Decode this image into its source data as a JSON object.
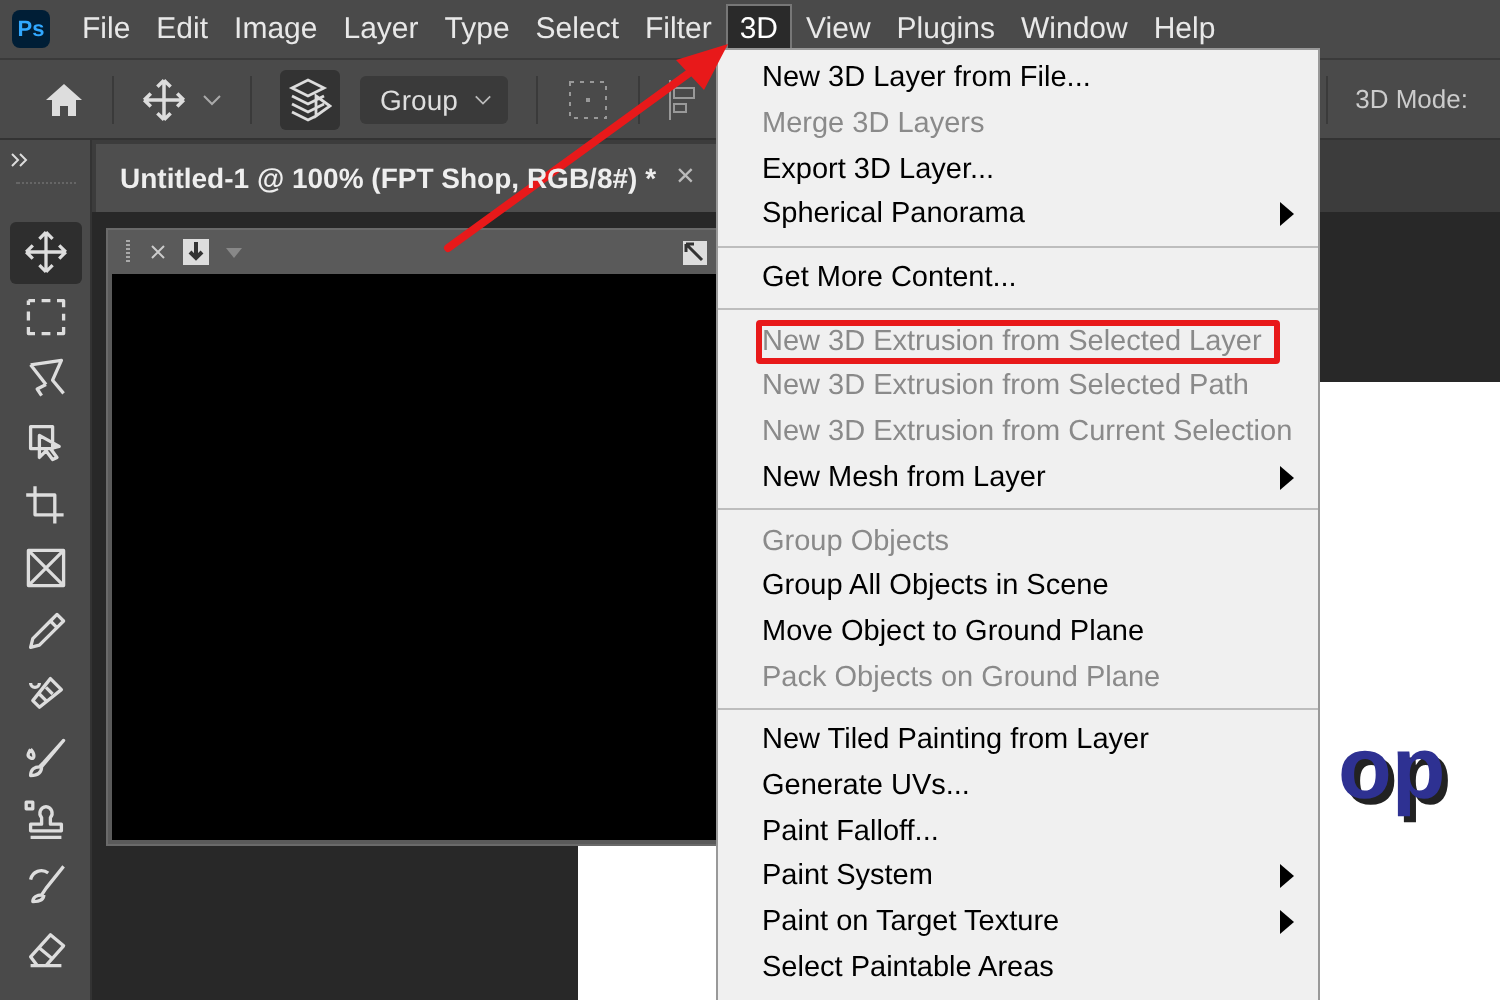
{
  "app_logo": "Ps",
  "menubar": [
    {
      "label": "File",
      "selected": false
    },
    {
      "label": "Edit",
      "selected": false
    },
    {
      "label": "Image",
      "selected": false
    },
    {
      "label": "Layer",
      "selected": false
    },
    {
      "label": "Type",
      "selected": false
    },
    {
      "label": "Select",
      "selected": false
    },
    {
      "label": "Filter",
      "selected": false
    },
    {
      "label": "3D",
      "selected": true
    },
    {
      "label": "View",
      "selected": false
    },
    {
      "label": "Plugins",
      "selected": false
    },
    {
      "label": "Window",
      "selected": false
    },
    {
      "label": "Help",
      "selected": false
    }
  ],
  "options_bar": {
    "group_dropdown": "Group",
    "mode_label": "3D Mode:"
  },
  "document_tab": {
    "title": "Untitled-1 @ 100% (FPT Shop, RGB/8#) *",
    "close": "×"
  },
  "canvas_text": "op",
  "tools": [
    {
      "kind": "move",
      "selected": true
    },
    {
      "kind": "marquee",
      "selected": false
    },
    {
      "kind": "lasso",
      "selected": false
    },
    {
      "kind": "object-select",
      "selected": false
    },
    {
      "kind": "crop",
      "selected": false
    },
    {
      "kind": "frame",
      "selected": false
    },
    {
      "kind": "eyedropper",
      "selected": false
    },
    {
      "kind": "healing",
      "selected": false
    },
    {
      "kind": "brush",
      "selected": false
    },
    {
      "kind": "stamp",
      "selected": false
    },
    {
      "kind": "history-brush",
      "selected": false
    },
    {
      "kind": "eraser",
      "selected": false
    }
  ],
  "menu": {
    "groups": [
      {
        "items": [
          {
            "label": "New 3D Layer from File...",
            "disabled": false,
            "submenu": false,
            "highlighted": false
          },
          {
            "label": "Merge 3D Layers",
            "disabled": true,
            "submenu": false,
            "highlighted": false
          },
          {
            "label": "Export 3D Layer...",
            "disabled": false,
            "submenu": false,
            "highlighted": false
          },
          {
            "label": "Spherical Panorama",
            "disabled": false,
            "submenu": true,
            "highlighted": false
          }
        ]
      },
      {
        "items": [
          {
            "label": "Get More Content...",
            "disabled": false,
            "submenu": false,
            "highlighted": false
          }
        ]
      },
      {
        "items": [
          {
            "label": "New 3D Extrusion from Selected Layer",
            "disabled": true,
            "submenu": false,
            "highlighted": true
          },
          {
            "label": "New 3D Extrusion from Selected Path",
            "disabled": true,
            "submenu": false,
            "highlighted": false
          },
          {
            "label": "New 3D Extrusion from Current Selection",
            "disabled": true,
            "submenu": false,
            "highlighted": false
          },
          {
            "label": "New Mesh from Layer",
            "disabled": false,
            "submenu": true,
            "highlighted": false
          }
        ]
      },
      {
        "items": [
          {
            "label": "Group Objects",
            "disabled": true,
            "submenu": false,
            "highlighted": false
          },
          {
            "label": "Group All Objects in Scene",
            "disabled": false,
            "submenu": false,
            "highlighted": false
          },
          {
            "label": "Move Object to Ground Plane",
            "disabled": false,
            "submenu": false,
            "highlighted": false
          },
          {
            "label": "Pack Objects on Ground Plane",
            "disabled": true,
            "submenu": false,
            "highlighted": false
          }
        ]
      },
      {
        "items": [
          {
            "label": "New Tiled Painting from Layer",
            "disabled": false,
            "submenu": false,
            "highlighted": false
          },
          {
            "label": "Generate UVs...",
            "disabled": false,
            "submenu": false,
            "highlighted": false
          },
          {
            "label": "Paint Falloff...",
            "disabled": false,
            "submenu": false,
            "highlighted": false
          },
          {
            "label": "Paint System",
            "disabled": false,
            "submenu": true,
            "highlighted": false
          },
          {
            "label": "Paint on Target Texture",
            "disabled": false,
            "submenu": true,
            "highlighted": false
          },
          {
            "label": "Select Paintable Areas",
            "disabled": false,
            "submenu": false,
            "highlighted": false
          }
        ]
      }
    ]
  }
}
